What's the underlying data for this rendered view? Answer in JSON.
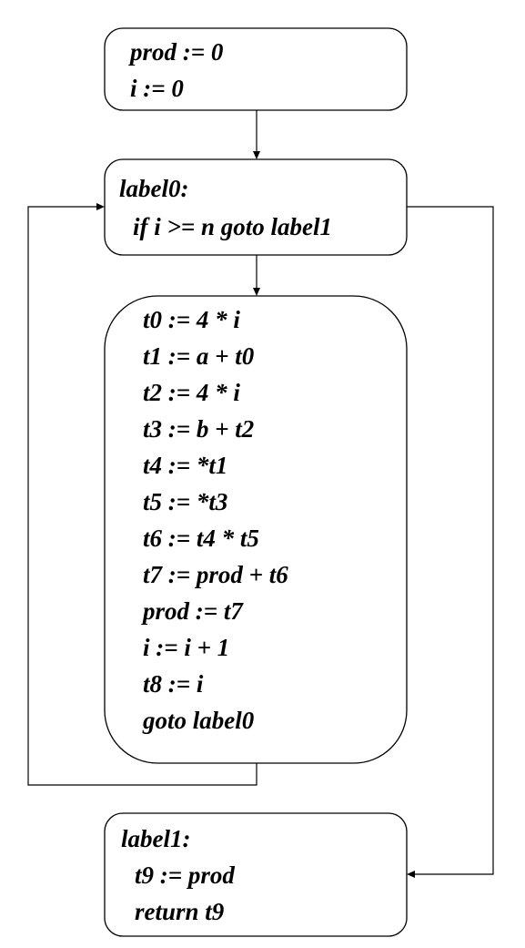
{
  "blocks": {
    "entry": {
      "lines": [
        "prod := 0",
        "i := 0"
      ]
    },
    "loop_header": {
      "lines": [
        "label0:",
        "if i >= n goto label1"
      ]
    },
    "loop_body": {
      "lines": [
        "t0 := 4  * i",
        "t1 := a + t0",
        "t2 := 4  * i",
        "t3 := b + t2",
        "t4 := *t1",
        "t5 := *t3",
        "t6 := t4  * t5",
        "t7 := prod + t6",
        "prod := t7",
        "i := i + 1",
        "t8 := i",
        "goto label0"
      ]
    },
    "exit": {
      "lines": [
        "label1:",
        "t9 := prod",
        "return t9"
      ]
    }
  },
  "edges": [
    {
      "from": "entry",
      "to": "loop_header"
    },
    {
      "from": "loop_header",
      "to": "loop_body"
    },
    {
      "from": "loop_body",
      "to": "loop_header"
    },
    {
      "from": "loop_header",
      "to": "exit"
    }
  ]
}
